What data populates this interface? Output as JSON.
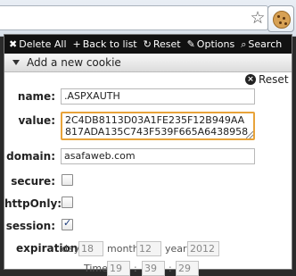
{
  "browser": {
    "star_icon": "star-icon",
    "extension_icon": "cookie-icon"
  },
  "toolbar": {
    "delete_all": "Delete All",
    "back_to_list": "Back to list",
    "reset": "Reset",
    "options": "Options",
    "search": "Search"
  },
  "section": {
    "title": "Add a new cookie"
  },
  "form": {
    "reset_label": "Reset",
    "name_label": "name:",
    "name_value": ".ASPXAUTH",
    "value_label": "value:",
    "value_value": "2C4DB8113D03A1FE235F12B949AA817ADA135C743F539F665A6438958",
    "domain_label": "domain:",
    "domain_value": "asafaweb.com",
    "secure_label": "secure:",
    "secure_checked": false,
    "httponly_label": "httpOnly:",
    "httponly_checked": false,
    "session_label": "session:",
    "session_checked": true,
    "expiration_label": "expiration:",
    "day_label": "day",
    "day_value": "18",
    "month_label": "month",
    "month_value": "12",
    "year_label": "year",
    "year_value": "2012",
    "time_label": "Time",
    "hour_value": "19",
    "minute_value": "39",
    "second_value": "29",
    "time_separator": ":"
  }
}
